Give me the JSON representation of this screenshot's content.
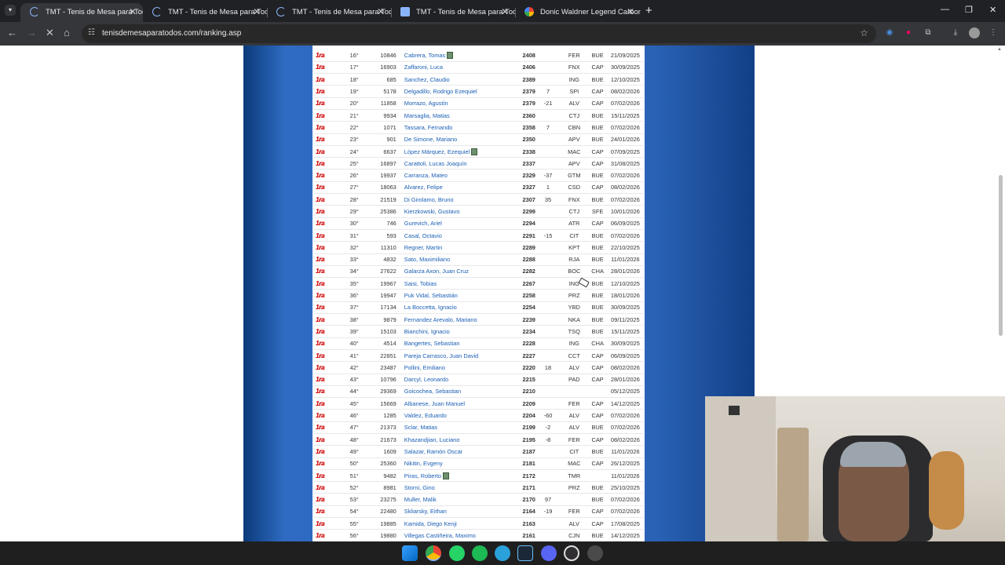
{
  "tabs": [
    {
      "title": "TMT - Tenis de Mesa para Todos",
      "active": true,
      "icon": "loading-spinner"
    },
    {
      "title": "TMT - Tenis de Mesa para Todos",
      "active": false,
      "icon": "loading-spinner"
    },
    {
      "title": "TMT - Tenis de Mesa para Todos",
      "active": false,
      "icon": "loading-spinner"
    },
    {
      "title": "TMT - Tenis de Mesa para Todos",
      "active": false,
      "icon": "page-icon"
    },
    {
      "title": "Donic Waldner Legend Carbon",
      "active": false,
      "icon": "google-icon"
    }
  ],
  "toolbar": {
    "url": "tenisdemesaparatodos.com/ranking.asp"
  },
  "ranking": {
    "category_badge": "1ra",
    "rows": [
      {
        "pos": "16°",
        "id": "10846",
        "name": "Cabrera, Tomas",
        "flag": true,
        "pts": "2408",
        "chg": "",
        "club": "FER",
        "prov": "BUE",
        "date": "21/09/2025"
      },
      {
        "pos": "17°",
        "id": "16903",
        "name": "Zaffaroni, Luca",
        "flag": false,
        "pts": "2406",
        "chg": "",
        "club": "FNX",
        "prov": "CAP",
        "date": "30/09/2025"
      },
      {
        "pos": "18°",
        "id": "685",
        "name": "Sanchez, Claudio",
        "flag": false,
        "pts": "2389",
        "chg": "",
        "club": "ING",
        "prov": "BUE",
        "date": "12/10/2025"
      },
      {
        "pos": "19°",
        "id": "5178",
        "name": "Delgadillo, Rodrigo Ezequiel",
        "flag": false,
        "pts": "2379",
        "chg": "7",
        "club": "SPI",
        "prov": "CAP",
        "date": "08/02/2026"
      },
      {
        "pos": "20°",
        "id": "11858",
        "name": "Morrazo, Agustín",
        "flag": false,
        "pts": "2379",
        "chg": "-21",
        "club": "ALV",
        "prov": "CAP",
        "date": "07/02/2026"
      },
      {
        "pos": "21°",
        "id": "9934",
        "name": "Marsaglia, Matias",
        "flag": false,
        "pts": "2360",
        "chg": "",
        "club": "CTJ",
        "prov": "BUE",
        "date": "15/11/2025"
      },
      {
        "pos": "22°",
        "id": "1071",
        "name": "Tassara, Fernando",
        "flag": false,
        "pts": "2358",
        "chg": "7",
        "club": "CBN",
        "prov": "BUE",
        "date": "07/02/2026"
      },
      {
        "pos": "23°",
        "id": "901",
        "name": "De Simone, Mariano",
        "flag": false,
        "pts": "2350",
        "chg": "",
        "club": "APV",
        "prov": "BUE",
        "date": "24/01/2026"
      },
      {
        "pos": "24°",
        "id": "6637",
        "name": "López Márquez, Ezequiel",
        "flag": true,
        "pts": "2338",
        "chg": "",
        "club": "MAC",
        "prov": "CAP",
        "date": "07/09/2025"
      },
      {
        "pos": "25°",
        "id": "16897",
        "name": "Carattoli, Lucas Joaquín",
        "flag": false,
        "pts": "2337",
        "chg": "",
        "club": "APV",
        "prov": "CAP",
        "date": "31/08/2025"
      },
      {
        "pos": "26°",
        "id": "19937",
        "name": "Carranza, Mateo",
        "flag": false,
        "pts": "2329",
        "chg": "-37",
        "club": "GTM",
        "prov": "BUE",
        "date": "07/02/2026"
      },
      {
        "pos": "27°",
        "id": "18063",
        "name": "Alvarez, Felipe",
        "flag": false,
        "pts": "2327",
        "chg": "1",
        "club": "CSD",
        "prov": "CAP",
        "date": "08/02/2026"
      },
      {
        "pos": "28°",
        "id": "21519",
        "name": "Di Girolamo, Bruno",
        "flag": false,
        "pts": "2307",
        "chg": "35",
        "club": "FNX",
        "prov": "BUE",
        "date": "07/02/2026"
      },
      {
        "pos": "29°",
        "id": "25386",
        "name": "Kierzkowski, Gustavo",
        "flag": false,
        "pts": "2299",
        "chg": "",
        "club": "CTJ",
        "prov": "SFE",
        "date": "10/01/2026"
      },
      {
        "pos": "30°",
        "id": "746",
        "name": "Gurevich, Ariel",
        "flag": false,
        "pts": "2294",
        "chg": "",
        "club": "ATR",
        "prov": "CAP",
        "date": "06/09/2025"
      },
      {
        "pos": "31°",
        "id": "593",
        "name": "Casal, Octavio",
        "flag": false,
        "pts": "2291",
        "chg": "-15",
        "club": "CIT",
        "prov": "BUE",
        "date": "07/02/2026"
      },
      {
        "pos": "32°",
        "id": "11310",
        "name": "Regner, Martin",
        "flag": false,
        "pts": "2289",
        "chg": "",
        "club": "KPT",
        "prov": "BUE",
        "date": "22/10/2025"
      },
      {
        "pos": "33°",
        "id": "4832",
        "name": "Sato, Maximiliano",
        "flag": false,
        "pts": "2288",
        "chg": "",
        "club": "RJA",
        "prov": "BUE",
        "date": "11/01/2026"
      },
      {
        "pos": "34°",
        "id": "27622",
        "name": "Galarza Axon, Juan Cruz",
        "flag": false,
        "pts": "2282",
        "chg": "",
        "club": "BOC",
        "prov": "CHA",
        "date": "28/01/2026"
      },
      {
        "pos": "35°",
        "id": "19967",
        "name": "Saisi, Tobias",
        "flag": false,
        "pts": "2267",
        "chg": "",
        "club": "ING",
        "prov": "BUE",
        "date": "12/10/2025"
      },
      {
        "pos": "36°",
        "id": "19947",
        "name": "Puk Vidal, Sebastián",
        "flag": false,
        "pts": "2258",
        "chg": "",
        "club": "PRZ",
        "prov": "BUE",
        "date": "18/01/2026"
      },
      {
        "pos": "37°",
        "id": "17134",
        "name": "La Boccetta, Ignacio",
        "flag": false,
        "pts": "2254",
        "chg": "",
        "club": "YBD",
        "prov": "BUE",
        "date": "30/09/2025"
      },
      {
        "pos": "38°",
        "id": "9879",
        "name": "Fernandez Arevalo, Mariano",
        "flag": false,
        "pts": "2239",
        "chg": "",
        "club": "NKA",
        "prov": "BUE",
        "date": "09/11/2025"
      },
      {
        "pos": "39°",
        "id": "15103",
        "name": "Bianchini, Ignacio",
        "flag": false,
        "pts": "2234",
        "chg": "",
        "club": "TSQ",
        "prov": "BUE",
        "date": "15/11/2025"
      },
      {
        "pos": "40°",
        "id": "4514",
        "name": "Bangertes, Sebastian",
        "flag": false,
        "pts": "2228",
        "chg": "",
        "club": "ING",
        "prov": "CHA",
        "date": "30/09/2025"
      },
      {
        "pos": "41°",
        "id": "22851",
        "name": "Pareja Carrasco, Juan David",
        "flag": false,
        "pts": "2227",
        "chg": "",
        "club": "CCT",
        "prov": "CAP",
        "date": "06/09/2025"
      },
      {
        "pos": "42°",
        "id": "23487",
        "name": "Pollini, Emiliano",
        "flag": false,
        "pts": "2220",
        "chg": "18",
        "club": "ALV",
        "prov": "CAP",
        "date": "08/02/2026"
      },
      {
        "pos": "43°",
        "id": "10796",
        "name": "Darcyl, Leonardo",
        "flag": false,
        "pts": "2215",
        "chg": "",
        "club": "PAD",
        "prov": "CAP",
        "date": "28/01/2026"
      },
      {
        "pos": "44°",
        "id": "29369",
        "name": "Goicochea, Sebastian",
        "flag": false,
        "pts": "2210",
        "chg": "",
        "club": "",
        "prov": "",
        "date": "05/12/2025"
      },
      {
        "pos": "45°",
        "id": "15669",
        "name": "Albanese, Juan Manuel",
        "flag": false,
        "pts": "2209",
        "chg": "",
        "club": "FER",
        "prov": "CAP",
        "date": "14/12/2025"
      },
      {
        "pos": "46°",
        "id": "1285",
        "name": "Valdez, Eduardo",
        "flag": false,
        "pts": "2204",
        "chg": "-60",
        "club": "ALV",
        "prov": "CAP",
        "date": "07/02/2026"
      },
      {
        "pos": "47°",
        "id": "21373",
        "name": "Sclar, Matias",
        "flag": false,
        "pts": "2199",
        "chg": "-2",
        "club": "ALV",
        "prov": "BUE",
        "date": "07/02/2026"
      },
      {
        "pos": "48°",
        "id": "21673",
        "name": "Khazandjian, Luciano",
        "flag": false,
        "pts": "2195",
        "chg": "-8",
        "club": "FER",
        "prov": "CAP",
        "date": "08/02/2026"
      },
      {
        "pos": "49°",
        "id": "1609",
        "name": "Salazar, Ramón Oscar",
        "flag": false,
        "pts": "2187",
        "chg": "",
        "club": "CIT",
        "prov": "BUE",
        "date": "11/01/2026"
      },
      {
        "pos": "50°",
        "id": "25360",
        "name": "Nikitin, Evgeny",
        "flag": false,
        "pts": "2181",
        "chg": "",
        "club": "MAC",
        "prov": "CAP",
        "date": "26/12/2025"
      },
      {
        "pos": "51°",
        "id": "9482",
        "name": "Piras, Roberto",
        "flag": true,
        "pts": "2172",
        "chg": "",
        "club": "TMR",
        "prov": "",
        "date": "11/01/2026"
      },
      {
        "pos": "52°",
        "id": "8981",
        "name": "Storni, Gino",
        "flag": false,
        "pts": "2171",
        "chg": "",
        "club": "PRZ",
        "prov": "BUE",
        "date": "25/10/2025"
      },
      {
        "pos": "53°",
        "id": "23275",
        "name": "Muller, Malik",
        "flag": false,
        "pts": "2170",
        "chg": "97",
        "club": "",
        "prov": "BUE",
        "date": "07/02/2026"
      },
      {
        "pos": "54°",
        "id": "22480",
        "name": "Skliarsky, Eithan",
        "flag": false,
        "pts": "2164",
        "chg": "-19",
        "club": "FER",
        "prov": "CAP",
        "date": "07/02/2026"
      },
      {
        "pos": "55°",
        "id": "19885",
        "name": "Kamida, Diego Kenji",
        "flag": false,
        "pts": "2163",
        "chg": "",
        "club": "ALV",
        "prov": "CAP",
        "date": "17/08/2025"
      },
      {
        "pos": "56°",
        "id": "19880",
        "name": "Villegas Castiñeira, Maximo",
        "flag": false,
        "pts": "2161",
        "chg": "",
        "club": "CJN",
        "prov": "BUE",
        "date": "14/12/2025"
      }
    ]
  },
  "colors": {
    "badge_red": "#dd1111",
    "link_blue": "#1a5fb4",
    "page_blue": "#2a63b6",
    "tabbar": "#202124"
  },
  "taskbar": {
    "icons": [
      "windows-start-icon",
      "chrome-icon",
      "whatsapp-icon",
      "spotify-icon",
      "telegram-icon",
      "steam-icon",
      "discord-icon",
      "obs-icon",
      "settings-icon"
    ]
  }
}
